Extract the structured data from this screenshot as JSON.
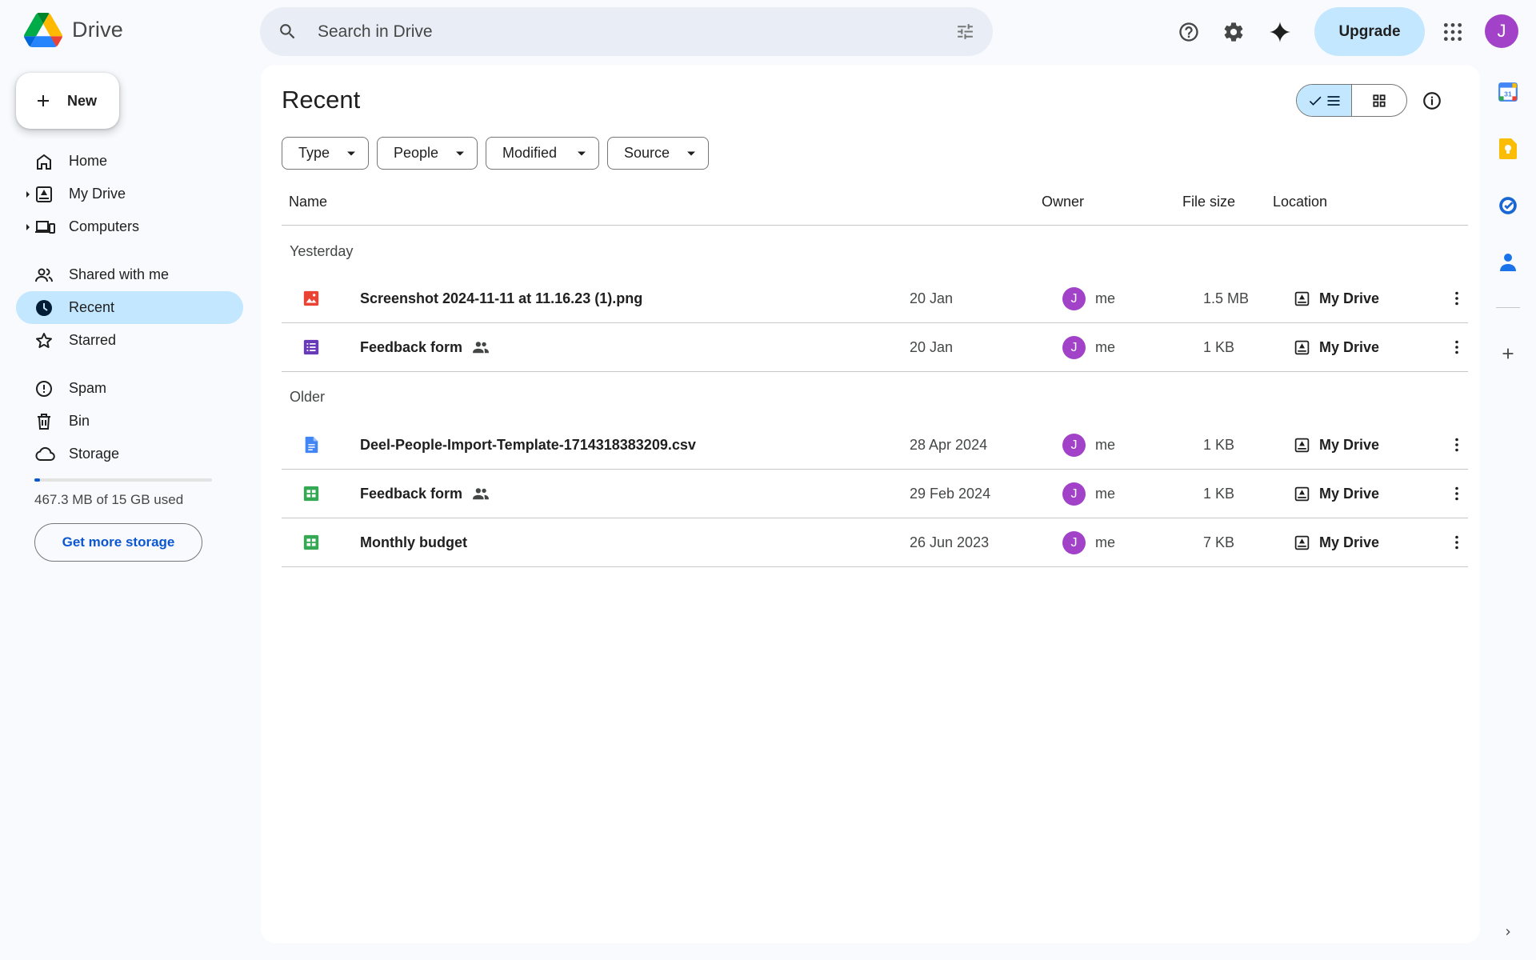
{
  "app": {
    "name": "Drive"
  },
  "search": {
    "placeholder": "Search in Drive"
  },
  "topbar": {
    "upgrade_label": "Upgrade",
    "account_initial": "J"
  },
  "sidebar": {
    "new_label": "New",
    "items": [
      {
        "label": "Home",
        "icon": "home-icon"
      },
      {
        "label": "My Drive",
        "icon": "my-drive-icon"
      },
      {
        "label": "Computers",
        "icon": "computers-icon"
      },
      {
        "label": "Shared with me",
        "icon": "shared-icon"
      },
      {
        "label": "Recent",
        "icon": "recent-icon",
        "active": true
      },
      {
        "label": "Starred",
        "icon": "star-icon"
      },
      {
        "label": "Spam",
        "icon": "spam-icon"
      },
      {
        "label": "Bin",
        "icon": "bin-icon"
      },
      {
        "label": "Storage",
        "icon": "cloud-icon"
      }
    ],
    "storage": {
      "text": "467.3 MB of 15 GB used",
      "used_fraction": 0.031,
      "button_label": "Get more storage"
    }
  },
  "main": {
    "title": "Recent",
    "filters": [
      "Type",
      "People",
      "Modified",
      "Source"
    ],
    "columns": {
      "name": "Name",
      "owner": "Owner",
      "size": "File size",
      "location": "Location"
    },
    "groups": [
      {
        "label": "Yesterday",
        "files": [
          {
            "name": "Screenshot 2024-11-11 at 11.16.23 (1).png",
            "type": "image",
            "shared": false,
            "date": "20 Jan",
            "owner_initial": "J",
            "owner": "me",
            "size": "1.5 MB",
            "location": "My Drive"
          },
          {
            "name": "Feedback form",
            "type": "form",
            "shared": true,
            "date": "20 Jan",
            "owner_initial": "J",
            "owner": "me",
            "size": "1 KB",
            "location": "My Drive"
          }
        ]
      },
      {
        "label": "Older",
        "files": [
          {
            "name": "Deel-People-Import-Template-1714318383209.csv",
            "type": "doc",
            "shared": false,
            "date": "28 Apr 2024",
            "owner_initial": "J",
            "owner": "me",
            "size": "1 KB",
            "location": "My Drive"
          },
          {
            "name": "Feedback form",
            "type": "sheet",
            "shared": true,
            "date": "29 Feb 2024",
            "owner_initial": "J",
            "owner": "me",
            "size": "1 KB",
            "location": "My Drive"
          },
          {
            "name": "Monthly budget",
            "type": "sheet",
            "shared": false,
            "date": "26 Jun 2023",
            "owner_initial": "J",
            "owner": "me",
            "size": "7 KB",
            "location": "My Drive"
          }
        ]
      }
    ]
  },
  "colors": {
    "accent": "#0b57d0",
    "active_bg": "#c2e7ff",
    "avatar": "#a142c8",
    "image_icon": "#ea4335",
    "form_icon": "#673ab7",
    "doc_icon": "#4285f4",
    "sheet_icon": "#34a853"
  }
}
